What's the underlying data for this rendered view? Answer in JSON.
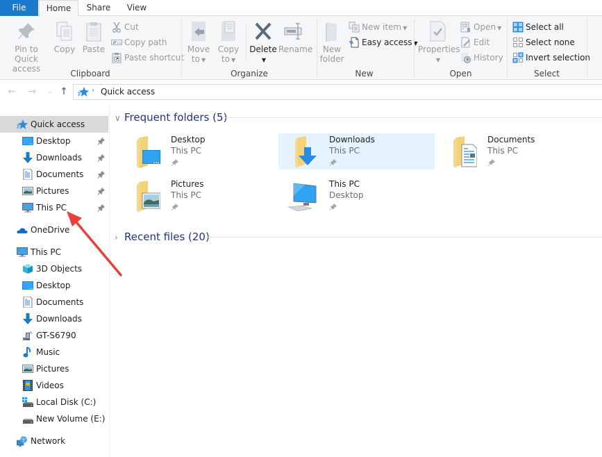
{
  "tabs": [
    {
      "label": "File",
      "active": false
    },
    {
      "label": "Home",
      "active": true
    },
    {
      "label": "Share",
      "active": false
    },
    {
      "label": "View",
      "active": false
    }
  ],
  "ribbon": {
    "clipboard": {
      "group_label": "Clipboard",
      "pin_to_quick_access": "Pin to Quick access",
      "pin_line1": "Pin to Quick",
      "pin_line2": "access",
      "copy": "Copy",
      "paste": "Paste",
      "cut": "Cut",
      "copy_path": "Copy path",
      "paste_shortcut": "Paste shortcut"
    },
    "organize": {
      "group_label": "Organize",
      "move_to_line1": "Move",
      "move_to_line2": "to",
      "copy_to_line1": "Copy",
      "copy_to_line2": "to",
      "delete": "Delete",
      "rename": "Rename"
    },
    "new": {
      "group_label": "New",
      "new_folder_line1": "New",
      "new_folder_line2": "folder",
      "new_item": "New item",
      "easy_access": "Easy access"
    },
    "open": {
      "group_label": "Open",
      "properties": "Properties",
      "open": "Open",
      "edit": "Edit",
      "history": "History"
    },
    "select": {
      "group_label": "Select",
      "select_all": "Select all",
      "select_none": "Select none",
      "invert_selection": "Invert selection"
    }
  },
  "navigation": {
    "back_icon": "arrow-left",
    "forward_icon": "arrow-right",
    "recent_icon": "chevron-down",
    "up_icon": "arrow-up",
    "breadcrumb": [
      "Quick access"
    ]
  },
  "sidebar": {
    "quick_access": {
      "label": "Quick access",
      "selected": true
    },
    "quick_access_items": [
      {
        "label": "Desktop",
        "icon": "desktop-icon",
        "pinned": true
      },
      {
        "label": "Downloads",
        "icon": "downloads-icon",
        "pinned": true
      },
      {
        "label": "Documents",
        "icon": "documents-icon",
        "pinned": true
      },
      {
        "label": "Pictures",
        "icon": "pictures-icon",
        "pinned": true
      },
      {
        "label": "This PC",
        "icon": "this-pc-icon",
        "pinned": true
      }
    ],
    "onedrive": {
      "label": "OneDrive"
    },
    "this_pc": {
      "label": "This PC"
    },
    "this_pc_items": [
      {
        "label": "3D Objects",
        "icon": "3d-objects-icon"
      },
      {
        "label": "Desktop",
        "icon": "desktop-icon"
      },
      {
        "label": "Documents",
        "icon": "documents-icon"
      },
      {
        "label": "Downloads",
        "icon": "downloads-icon"
      },
      {
        "label": "GT-S6790",
        "icon": "phone-device-icon"
      },
      {
        "label": "Music",
        "icon": "music-icon"
      },
      {
        "label": "Pictures",
        "icon": "pictures-icon"
      },
      {
        "label": "Videos",
        "icon": "videos-icon"
      },
      {
        "label": "Local Disk (C:)",
        "icon": "local-disk-icon"
      },
      {
        "label": "New Volume (E:)",
        "icon": "drive-icon"
      }
    ],
    "network": {
      "label": "Network"
    }
  },
  "main": {
    "frequent_folders": {
      "title": "Frequent folders (5)",
      "expanded": true,
      "items": [
        {
          "name": "Desktop",
          "location": "This PC",
          "pinned": true,
          "selected": false,
          "icon": "desktop-folder-icon"
        },
        {
          "name": "Downloads",
          "location": "This PC",
          "pinned": true,
          "selected": true,
          "icon": "downloads-folder-icon"
        },
        {
          "name": "Documents",
          "location": "This PC",
          "pinned": true,
          "selected": false,
          "icon": "documents-folder-icon"
        },
        {
          "name": "Pictures",
          "location": "This PC",
          "pinned": true,
          "selected": false,
          "icon": "pictures-folder-icon"
        },
        {
          "name": "This PC",
          "location": "Desktop",
          "pinned": true,
          "selected": false,
          "icon": "this-pc-icon"
        }
      ]
    },
    "recent_files": {
      "title": "Recent files (20)",
      "expanded": false
    }
  },
  "annotation": {
    "type": "red-arrow",
    "points_to": "This PC",
    "color": "#e8413a"
  },
  "colors": {
    "file_tab": "#1979ca",
    "ribbon_bg": "#f5f6f7",
    "selected_nav": "#d9d9d9",
    "selected_tile": "#e5f3ff",
    "section_header": "#1e3287"
  }
}
